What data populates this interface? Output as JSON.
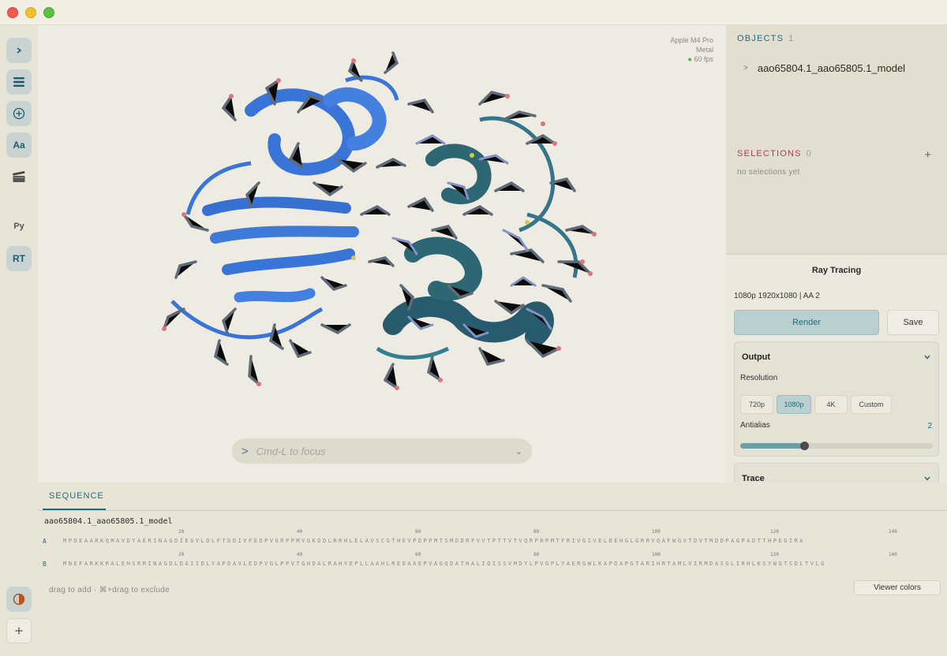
{
  "viewer": {
    "gpu_name": "Apple M4 Pro",
    "gpu_api": "Metal",
    "fps": "60 fps",
    "command_placeholder": "Cmd-L to focus"
  },
  "leftbar": {
    "text_button": "Aa",
    "python_button": "Py",
    "rt_button": "RT"
  },
  "objects": {
    "title": "OBJECTS",
    "count": "1",
    "items": [
      {
        "name": "aao65804.1_aao65805.1_model"
      }
    ]
  },
  "selections": {
    "title": "SELECTIONS",
    "count": "0",
    "empty_text": "no selections yet"
  },
  "ray_tracing": {
    "title": "Ray Tracing",
    "info": "1080p 1920x1080 | AA 2",
    "render_label": "Render",
    "save_label": "Save",
    "output": {
      "title": "Output",
      "resolution_label": "Resolution",
      "resolutions": [
        "720p",
        "1080p",
        "4K",
        "Custom"
      ],
      "selected_resolution": "1080p",
      "antialias_label": "Antialias",
      "antialias_value": "2",
      "antialias_fraction": 0.33
    },
    "trace": {
      "title": "Trace"
    }
  },
  "sequence": {
    "tab_label": "SEQUENCE",
    "model_name": "aao65804.1_aao65805.1_model",
    "ruler_marks": [
      "20",
      "40",
      "60",
      "80",
      "100",
      "120",
      "140"
    ],
    "chains": [
      {
        "id": "A",
        "sequence": "MPDEAARKQMAVDYAERINAGDIEGVLDLFTDDIVFEDPVGRPPMVGKDDLRRHLELAVSCGTHEVPDPPMTSMDDRFVVTPTTVTVQRPRPMTFRIVGIVELDEHGLGRRVQAFWGVTDVTMDDPAGPADTTHPEGIRA"
      },
      {
        "id": "B",
        "sequence": "MNEFARKKRALEHSRRINAGDLDAIIDLYAPDAVLEDPVGLPPVTGHDALRAHYEPLLAAHLREEAAEPVAGQDATHALIQISSVMDYLPVGPLYAERGWLKAPDAPGTARIHRTAMLVIRMDASGLIRHLKSYWGTSDLTVLG"
      }
    ],
    "hint": "drag to add · ⌘+drag to exclude",
    "viewer_colors_label": "Viewer colors"
  },
  "colors": {
    "accent": "#1f6b80",
    "selections_title": "#b8374a",
    "chain_a": "#2f6fd6",
    "chain_b": "#1f5468"
  }
}
